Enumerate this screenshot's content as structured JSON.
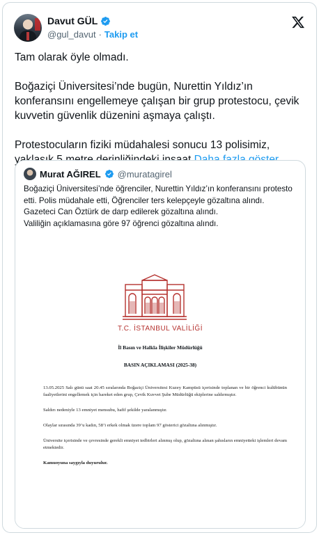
{
  "author": {
    "name": "Davut GÜL",
    "handle": "@gul_davut",
    "separator": "·",
    "follow_label": "Takip et"
  },
  "tweet": {
    "paragraphs": [
      "Tam olarak öyle olmadı.",
      "Boğaziçi Üniversitesi’nde bugün, Nurettin Yıldız’ın konferansını engellemeye çalışan bir grup protestocu, çevik kuvvetin güvenlik düzenini aşmaya çalıştı.",
      "Protestocuların fiziki müdahalesi sonucu 13 polisimiz, yaklaşık 5 metre derinliğindeki inşaat"
    ],
    "show_more": "Daha fazla göster"
  },
  "quote": {
    "name": "Murat AĞIREL",
    "handle": "@muratagirel",
    "lines": [
      "Boğaziçi Üniversitesi’nde öğrenciler, Nurettin Yıldız’ın konferansını protesto etti. Polis müdahale etti, Öğrenciler ters kelepçeyle gözaltına alındı.",
      "Gazeteci Can Öztürk de darp edilerek gözaltına alındı.",
      "Valiliğin açıklamasına göre 97 öğrenci gözaltına alındı."
    ]
  },
  "document": {
    "issuer": "T.C. İSTANBUL VALİLİĞİ",
    "unit": "İl Basın ve Halkla İlişkiler Müdürlüğü",
    "title": "BASIN AÇIKLAMASI (2025-38)",
    "paragraphs": [
      "13.05.2025 Salı günü saat 20.45 sıralarında Boğaziçi Üniversitesi Kuzey Kampüsü içerisinde toplanan ve bir öğrenci kulübünün faaliyetlerini engellemek için hareket eden grup, Çevik Kuvvet Şube Müdürlüğü ekiplerine saldırmıştır.",
      "Saldırı nedeniyle 13 emniyet mensubu, hafif şekilde yaralanmıştır.",
      "Olaylar sırasında 39’u kadın, 58’i erkek olmak üzere toplam 97 gösterici gözaltına alınmıştır.",
      "Üniversite içerisinde ve çevresinde gerekli emniyet tedbirleri alınmış olup, gözaltına alınan şahısların emniyetteki işlemleri devam etmektedir."
    ],
    "closing": "Kamuoyuna saygıyla duyurulur."
  },
  "colors": {
    "accent": "#1d9bf0",
    "text": "#0f1419",
    "muted": "#536471",
    "border": "#cfd9de",
    "valilik_red": "#b5322f"
  },
  "icons": {
    "verified": "verified-badge-icon",
    "x_logo": "x-logo-icon"
  }
}
